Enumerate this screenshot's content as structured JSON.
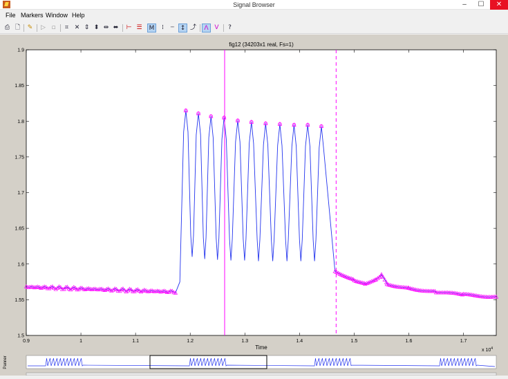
{
  "window": {
    "title": "Signal Browser",
    "minimize": "–",
    "maximize": "☐",
    "close": "✕"
  },
  "menu": [
    "File",
    "Markers",
    "Window",
    "Help"
  ],
  "toolbar_icons": [
    "print-icon",
    "print-preview-icon",
    "select-trace-icon",
    "play-icon",
    "stop-icon",
    "zoom-box-icon",
    "full-view-icon",
    "zoom-in-y-icon",
    "zoom-out-y-icon",
    "zoom-in-x-icon",
    "zoom-out-x-icon",
    "vertical-markers-icon",
    "horizontal-markers-icon",
    "track-markers-icon",
    "slope-markers-icon",
    "peaks-icon",
    "valleys-icon",
    "marker-settings-icon",
    "markers-show-icon",
    "markers-hide-icon",
    "help-icon"
  ],
  "plot": {
    "title": "fig12 (34203x1 real, Fs=1)",
    "xlabel": "Time",
    "x_multiplier": "x 10",
    "x_multiplier_exp": "4",
    "panner_label": "Panner"
  },
  "colors": {
    "signal": "#2233ee",
    "markers": "#ff00ff",
    "background": "#ffffff"
  },
  "chart_data": {
    "type": "line",
    "xlim": [
      9000,
      17600
    ],
    "ylim": [
      1.5,
      1.9
    ],
    "x_ticks": [
      9000,
      10000,
      11000,
      12000,
      13000,
      14000,
      15000,
      16000,
      17000
    ],
    "x_tick_labels": [
      "0.9",
      "1",
      "1.1",
      "1.2",
      "1.3",
      "1.4",
      "1.5",
      "1.6",
      "1.7"
    ],
    "y_ticks": [
      1.5,
      1.55,
      1.6,
      1.65,
      1.7,
      1.75,
      1.8,
      1.85,
      1.9
    ],
    "y_tick_labels": [
      "1.5",
      "1.55",
      "1.6",
      "1.65",
      "1.7",
      "1.75",
      "1.8",
      "1.85",
      "1.9"
    ],
    "baseline_before": {
      "x": [
        9000,
        11750
      ],
      "y": [
        1.568,
        1.561
      ]
    },
    "peaks": [
      {
        "x": 11920,
        "y": 1.815
      },
      {
        "x": 12150,
        "y": 1.811
      },
      {
        "x": 12380,
        "y": 1.807
      },
      {
        "x": 12620,
        "y": 1.805
      },
      {
        "x": 12870,
        "y": 1.801
      },
      {
        "x": 13120,
        "y": 1.799
      },
      {
        "x": 13380,
        "y": 1.797
      },
      {
        "x": 13640,
        "y": 1.796
      },
      {
        "x": 13900,
        "y": 1.795
      },
      {
        "x": 14150,
        "y": 1.795
      },
      {
        "x": 14400,
        "y": 1.793
      }
    ],
    "valleys": [
      1.61,
      1.607,
      1.606,
      1.605,
      1.605,
      1.604,
      1.604,
      1.604,
      1.604,
      1.604
    ],
    "tail": {
      "x": [
        14650,
        15000,
        15200,
        15400,
        15500,
        15600,
        16000,
        16500,
        17000,
        17600
      ],
      "y": [
        1.59,
        1.578,
        1.573,
        1.579,
        1.585,
        1.572,
        1.566,
        1.561,
        1.557,
        1.554
      ]
    },
    "marker_solid_x": 12630,
    "marker_dashed_x": 14670
  }
}
